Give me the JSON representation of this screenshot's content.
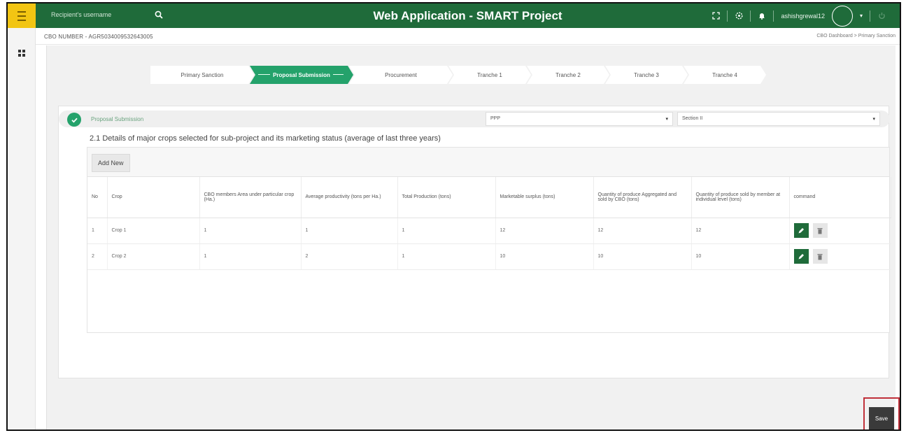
{
  "app": {
    "title": "Web Application - SMART Project",
    "search_placeholder": "Recipient's username",
    "username": "ashishgrewal12"
  },
  "cbo": {
    "number": "CBO NUMBER - AGR5034009532643005",
    "breadcrumb": "CBO Dashboard  >  Primary Sanction"
  },
  "steps": [
    {
      "label": "Primary Sanction",
      "active": false
    },
    {
      "label": "Proposal Submission",
      "active": true
    },
    {
      "label": "Procurement",
      "active": false
    },
    {
      "label": "Tranche 1",
      "active": false
    },
    {
      "label": "Tranche 2",
      "active": false
    },
    {
      "label": "Tranche 3",
      "active": false
    },
    {
      "label": "Tranche 4",
      "active": false
    }
  ],
  "section": {
    "title": "Proposal Submission",
    "select1": "PPP",
    "select2": "Section II",
    "heading": "2.1 Details of major crops selected for sub-project and its marketing status (average of last three years)"
  },
  "table": {
    "add_label": "Add New",
    "headers": [
      "No",
      "Crop",
      "CBO members Area under particular crop (Ha.)",
      "Average productivity (tons per Ha.)",
      "Total Production (tons)",
      "Marketable surplus (tons)",
      "Quantity of produce Aggregated and sold by CBO (tons)",
      "Quantity of produce sold by member at individual level (tons)",
      "command"
    ],
    "rows": [
      {
        "no": "1",
        "crop": "Crop 1",
        "area": "1",
        "productivity": "1",
        "total": "1",
        "surplus": "12",
        "aggregated": "12",
        "individual": "12"
      },
      {
        "no": "2",
        "crop": "Crop 2",
        "area": "1",
        "productivity": "2",
        "total": "1",
        "surplus": "10",
        "aggregated": "10",
        "individual": "10"
      }
    ]
  },
  "save_label": "Save",
  "colors": {
    "header_green": "#1f6b3a",
    "step_active": "#24a26b",
    "menu_yellow": "#f2c513",
    "highlight_red": "#c0303a"
  }
}
